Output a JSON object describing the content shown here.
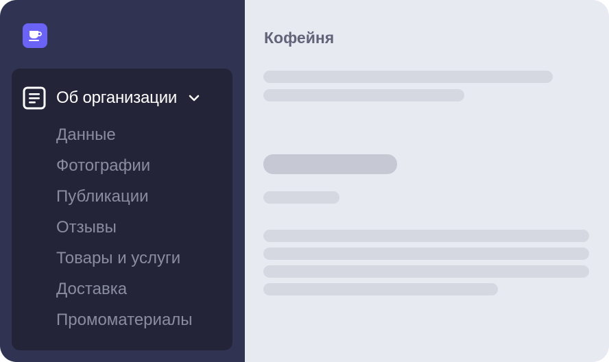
{
  "sidebar": {
    "logo_icon": "coffee-cup-icon",
    "section": {
      "icon": "document-icon",
      "label": "Об организации",
      "expand_icon": "chevron-down-icon",
      "items": [
        {
          "label": "Данные"
        },
        {
          "label": "Фотографии"
        },
        {
          "label": "Публикации"
        },
        {
          "label": "Отзывы"
        },
        {
          "label": "Товары и услуги"
        },
        {
          "label": "Доставка"
        },
        {
          "label": "Промоматериалы"
        }
      ]
    }
  },
  "main": {
    "title": "Кофейня"
  },
  "colors": {
    "sidebar_bg": "#303352",
    "nav_card_bg": "#232438",
    "accent": "#6b63f6",
    "content_bg": "#e8eaf2",
    "skeleton": "#d6d8e1"
  }
}
